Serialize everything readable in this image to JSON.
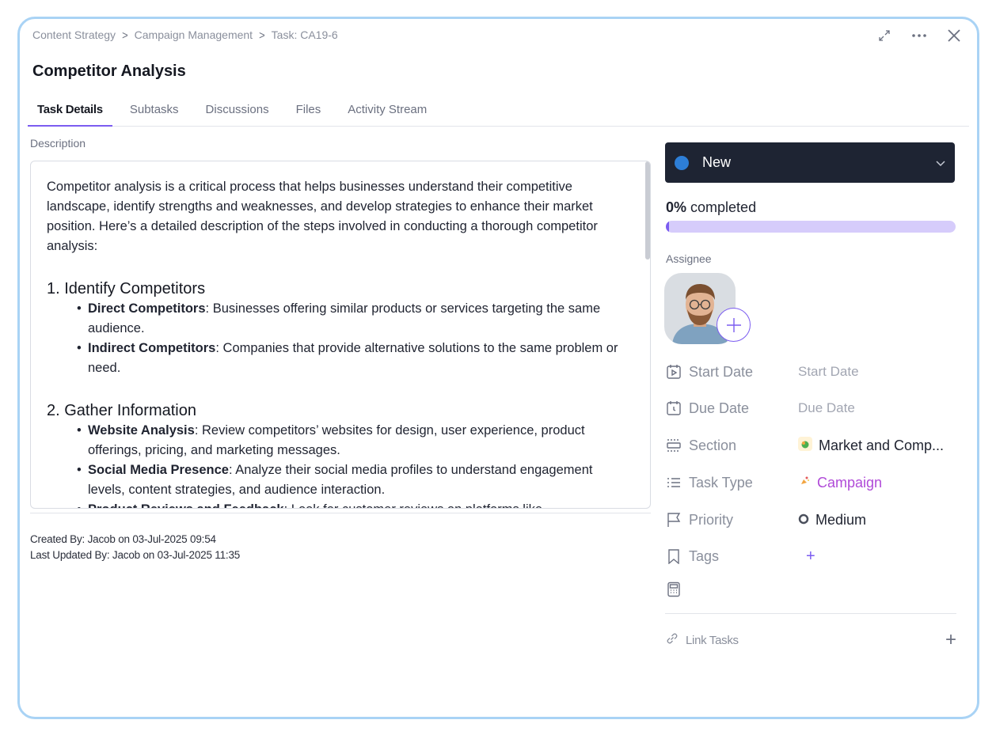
{
  "breadcrumb": [
    "Content Strategy",
    "Campaign Management",
    "Task: CA19-6"
  ],
  "title": "Competitor Analysis",
  "tabs": [
    "Task Details",
    "Subtasks",
    "Discussions",
    "Files",
    "Activity Stream"
  ],
  "active_tab": "Task Details",
  "description": {
    "label": "Description",
    "intro": "Competitor analysis is a critical process that helps businesses understand their competitive landscape, identify strengths and weaknesses, and develop strategies to enhance their market position. Here’s a detailed description of the steps involved in conducting a thorough competitor analysis:",
    "sections": [
      {
        "heading": "1. Identify Competitors",
        "items": [
          {
            "term": "Direct Competitors",
            "text": ": Businesses offering similar products or services targeting the same audience."
          },
          {
            "term": "Indirect Competitors",
            "text": ": Companies that provide alternative solutions to the same problem or need."
          }
        ]
      },
      {
        "heading": "2. Gather Information",
        "items": [
          {
            "term": "Website Analysis",
            "text": ": Review competitors’ websites for design, user experience, product offerings, pricing, and marketing messages."
          },
          {
            "term": "Social Media Presence",
            "text": ": Analyze their social media profiles to understand engagement levels, content strategies, and audience interaction."
          },
          {
            "term": "Product Reviews and Feedback",
            "text": ": Look for customer reviews on platforms like"
          }
        ]
      }
    ]
  },
  "meta": {
    "created": "Created By: Jacob on 03-Jul-2025 09:54",
    "updated": "Last Updated By: Jacob on 03-Jul-2025 11:35"
  },
  "status": {
    "label": "New",
    "color": "#2d7ed7"
  },
  "progress": {
    "percent": 0,
    "percent_text": "0%",
    "suffix": "completed"
  },
  "assignee": {
    "label": "Assignee"
  },
  "fields": {
    "start_date": {
      "name": "Start Date",
      "value": "Start Date"
    },
    "due_date": {
      "name": "Due Date",
      "value": "Due Date"
    },
    "section": {
      "name": "Section",
      "value": "Market and Comp..."
    },
    "task_type": {
      "name": "Task Type",
      "value": "Campaign"
    },
    "priority": {
      "name": "Priority",
      "value": "Medium"
    },
    "tags": {
      "name": "Tags",
      "add": "+"
    }
  },
  "link_tasks": {
    "label": "Link Tasks",
    "add": "+"
  },
  "colors": {
    "accent": "#7b5cf0",
    "status_bg": "#1e2433",
    "frame": "#a9d3f5",
    "task_type": "#b04ad8"
  }
}
